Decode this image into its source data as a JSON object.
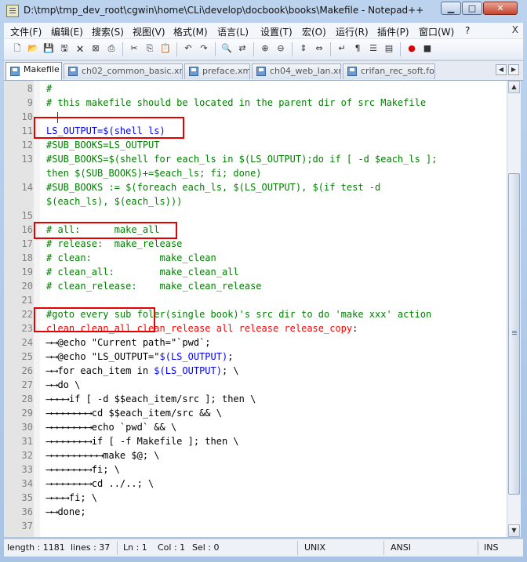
{
  "window": {
    "title": "D:\\tmp\\tmp_dev_root\\cgwin\\home\\CLi\\develop\\docbook\\books\\Makefile - Notepad++",
    "min_label": "▁",
    "max_label": "□",
    "close_label": "✕"
  },
  "menu": {
    "items": [
      "文件(F)",
      "编辑(E)",
      "搜索(S)",
      "视图(V)",
      "格式(M)",
      "语言(L)",
      "设置(T)",
      "宏(O)",
      "运行(R)",
      "插件(P)",
      "窗口(W)",
      "?"
    ],
    "close": "X"
  },
  "toolbar": {
    "icons": [
      "new-file-icon",
      "open-file-icon",
      "save-icon",
      "save-all-icon",
      "close-icon",
      "close-all-icon",
      "print-icon",
      "cut-icon",
      "copy-icon",
      "paste-icon",
      "undo-icon",
      "redo-icon",
      "find-icon",
      "replace-icon",
      "zoom-in-icon",
      "zoom-out-icon",
      "sync-v-icon",
      "sync-h-icon",
      "word-wrap-icon",
      "all-chars-icon",
      "indent-guide-icon",
      "user-lang-icon",
      "record-macro-icon",
      "stop-record-icon"
    ]
  },
  "tabs": [
    {
      "label": "Makefile",
      "active": true
    },
    {
      "label": "ch02_common_basic.xml",
      "active": false
    },
    {
      "label": "preface.xml",
      "active": false
    },
    {
      "label": "ch04_web_lan.xml",
      "active": false
    },
    {
      "label": "crifan_rec_soft.fo",
      "active": false
    }
  ],
  "tab_nav": {
    "prev": "◀",
    "next": "▶"
  },
  "lines": [
    {
      "n": "8",
      "segs": [
        {
          "t": "#",
          "c": "cmt"
        }
      ]
    },
    {
      "n": "9",
      "segs": [
        {
          "t": "# this makefile should be located in the parent dir of src Makefile",
          "c": "cmt"
        }
      ]
    },
    {
      "n": "10",
      "segs": []
    },
    {
      "n": "11",
      "segs": [
        {
          "t": "LS_OUTPUT=$(shell ls)",
          "c": "var"
        }
      ]
    },
    {
      "n": "12",
      "segs": [
        {
          "t": "#SUB_BOOKS=LS_OUTPUT",
          "c": "cmt"
        }
      ]
    },
    {
      "n": "13",
      "segs": [
        {
          "t": "#SUB_BOOKS=$(shell for each_ls in $(LS_OUTPUT);do if [ -d $each_ls ];",
          "c": "cmt"
        }
      ]
    },
    {
      "n": "",
      "segs": [
        {
          "t": "then $(SUB_BOOKS)+=$each_ls; fi; done)",
          "c": "cmt"
        }
      ]
    },
    {
      "n": "14",
      "segs": [
        {
          "t": "#SUB_BOOKS := $(foreach each_ls, $(LS_OUTPUT), $(if test -d",
          "c": "cmt"
        }
      ]
    },
    {
      "n": "",
      "segs": [
        {
          "t": "$(each_ls), $(each_ls)))",
          "c": "cmt"
        }
      ]
    },
    {
      "n": "15",
      "segs": []
    },
    {
      "n": "16",
      "segs": [
        {
          "t": "# all:      make_all",
          "c": "cmt"
        }
      ]
    },
    {
      "n": "17",
      "segs": [
        {
          "t": "# release:  make_release",
          "c": "cmt"
        }
      ]
    },
    {
      "n": "18",
      "segs": [
        {
          "t": "# clean:            make_clean",
          "c": "cmt"
        }
      ]
    },
    {
      "n": "19",
      "segs": [
        {
          "t": "# clean_all:        make_clean_all",
          "c": "cmt"
        }
      ]
    },
    {
      "n": "20",
      "segs": [
        {
          "t": "# clean_release:    make_clean_release",
          "c": "cmt"
        }
      ]
    },
    {
      "n": "21",
      "segs": []
    },
    {
      "n": "22",
      "segs": [
        {
          "t": "#goto every sub foler(single book)'s src dir to do 'make xxx' action",
          "c": "cmt"
        }
      ]
    },
    {
      "n": "23",
      "segs": [
        {
          "t": "clean clean_all clean_release all release release_copy",
          "c": "tgt"
        },
        {
          "t": ":",
          "c": "def"
        }
      ]
    },
    {
      "n": "24",
      "segs": [
        {
          "t": "⟶⟶",
          "c": "ws"
        },
        {
          "t": "@echo \"Current path=\"`pwd`;",
          "c": "def"
        }
      ]
    },
    {
      "n": "25",
      "segs": [
        {
          "t": "⟶⟶",
          "c": "ws"
        },
        {
          "t": "@echo \"LS_OUTPUT=\"",
          "c": "def"
        },
        {
          "t": "$(LS_OUTPUT)",
          "c": "var"
        },
        {
          "t": ";",
          "c": "def"
        }
      ]
    },
    {
      "n": "26",
      "segs": [
        {
          "t": "⟶⟶",
          "c": "ws"
        },
        {
          "t": "for each_item in ",
          "c": "def"
        },
        {
          "t": "$(LS_OUTPUT)",
          "c": "var"
        },
        {
          "t": "; \\",
          "c": "def"
        }
      ]
    },
    {
      "n": "27",
      "segs": [
        {
          "t": "⟶⟶",
          "c": "ws"
        },
        {
          "t": "do \\",
          "c": "def"
        }
      ]
    },
    {
      "n": "28",
      "segs": [
        {
          "t": "⟶⟶⟶⟶",
          "c": "ws"
        },
        {
          "t": "if [ -d $$each_item/src ]; then \\",
          "c": "def"
        }
      ]
    },
    {
      "n": "29",
      "segs": [
        {
          "t": "⟶⟶⟶⟶⟶⟶⟶⟶",
          "c": "ws"
        },
        {
          "t": "cd $$each_item/src && \\",
          "c": "def"
        }
      ]
    },
    {
      "n": "30",
      "segs": [
        {
          "t": "⟶⟶⟶⟶⟶⟶⟶⟶",
          "c": "ws"
        },
        {
          "t": "echo `pwd` && \\",
          "c": "def"
        }
      ]
    },
    {
      "n": "31",
      "segs": [
        {
          "t": "⟶⟶⟶⟶⟶⟶⟶⟶",
          "c": "ws"
        },
        {
          "t": "if [ -f Makefile ]; then \\",
          "c": "def"
        }
      ]
    },
    {
      "n": "32",
      "segs": [
        {
          "t": "⟶⟶⟶⟶⟶⟶⟶⟶⟶⟶",
          "c": "ws"
        },
        {
          "t": "make $@; \\",
          "c": "def"
        }
      ]
    },
    {
      "n": "33",
      "segs": [
        {
          "t": "⟶⟶⟶⟶⟶⟶⟶⟶",
          "c": "ws"
        },
        {
          "t": "fi; \\",
          "c": "def"
        }
      ]
    },
    {
      "n": "34",
      "segs": [
        {
          "t": "⟶⟶⟶⟶⟶⟶⟶⟶",
          "c": "ws"
        },
        {
          "t": "cd ../..; \\",
          "c": "def"
        }
      ]
    },
    {
      "n": "35",
      "segs": [
        {
          "t": "⟶⟶⟶⟶",
          "c": "ws"
        },
        {
          "t": "fi; \\",
          "c": "def"
        }
      ]
    },
    {
      "n": "36",
      "segs": [
        {
          "t": "⟶⟶",
          "c": "ws"
        },
        {
          "t": "done;",
          "c": "def"
        }
      ]
    },
    {
      "n": "37",
      "segs": []
    }
  ],
  "status": {
    "length": "length : 1181",
    "lines": "lines : 37",
    "ln": "Ln : 1",
    "col": "Col : 1",
    "sel": "Sel : 0",
    "eol": "UNIX",
    "encoding": "ANSI",
    "mode": "INS"
  },
  "colors": {
    "comment": "#008000",
    "variable": "#0000ff",
    "target": "#ff0000",
    "highlight_box": "#e60000"
  }
}
